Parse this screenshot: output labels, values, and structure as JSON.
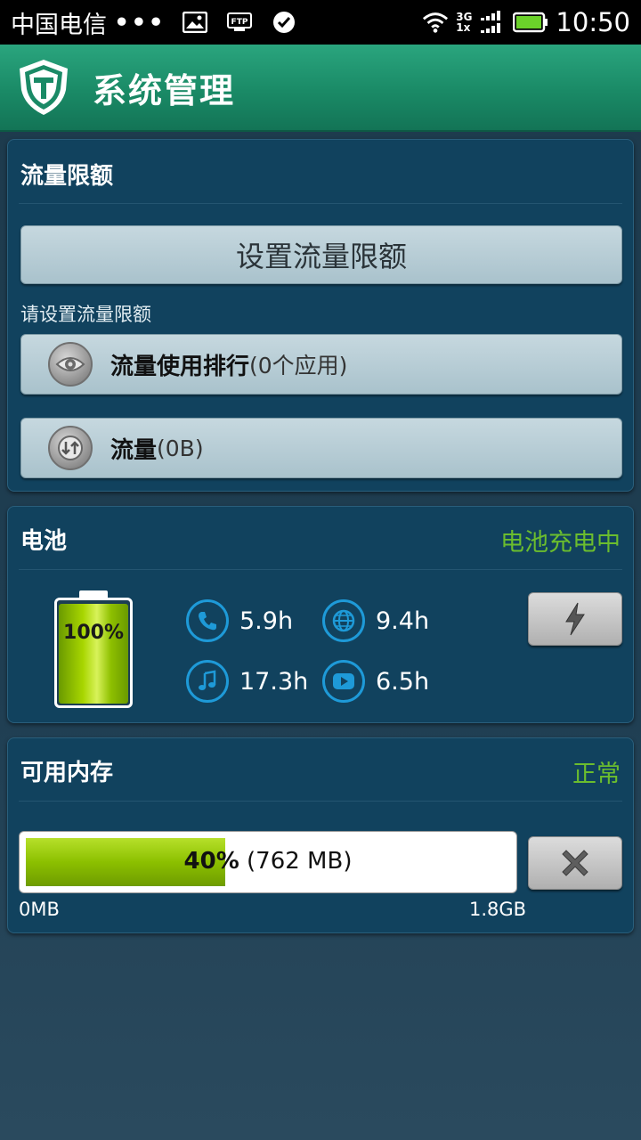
{
  "status_bar": {
    "carrier": "中国电信",
    "dots": "•••",
    "network_top": "3G",
    "network_bottom": "1x",
    "time": "10:50",
    "battery_color": "#6bd12a"
  },
  "app": {
    "title": "系统管理",
    "accent": "#1a8a66"
  },
  "traffic": {
    "title": "流量限额",
    "set_limit_label": "设置流量限额",
    "hint": "请设置流量限额",
    "ranking_label": "流量使用排行",
    "ranking_count": "(0个应用)",
    "flow_label": "流量",
    "flow_value": "(0B)"
  },
  "battery": {
    "title": "电池",
    "status": "电池充电中",
    "status_color": "#6bbd2e",
    "percent": "100%",
    "level": 1.0,
    "stats": [
      {
        "icon": "phone-icon",
        "value": "5.9h"
      },
      {
        "icon": "globe-icon",
        "value": "9.4h"
      },
      {
        "icon": "music-icon",
        "value": "17.3h"
      },
      {
        "icon": "video-icon",
        "value": "6.5h"
      }
    ]
  },
  "memory": {
    "title": "可用内存",
    "status": "正常",
    "percent": "40%",
    "amount": "(762 MB)",
    "fraction": 0.4,
    "min_label": "0MB",
    "max_label": "1.8GB"
  }
}
